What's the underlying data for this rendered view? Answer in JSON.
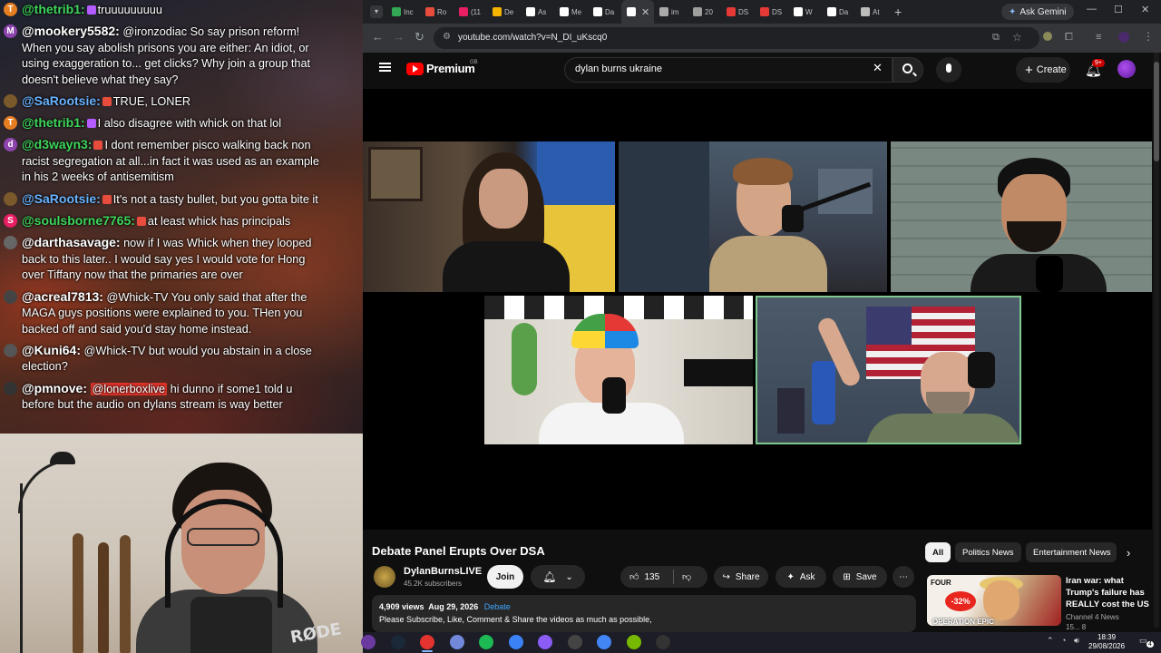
{
  "chat": {
    "messages": [
      {
        "user": "@thetrib1:",
        "avatar": "T",
        "avatar_color": "#e67e22",
        "user_color": "#3ed65b",
        "badge_color": "#b45cff",
        "text": "truuuuuuuuu",
        "mention": ""
      },
      {
        "user": "@mookery5582:",
        "avatar": "M",
        "avatar_color": "#8e44ad",
        "user_color": "#ffffff",
        "badge_color": "",
        "text": "@ironzodiac So say prison reform! When you say abolish prisons you are either: An idiot, or using exaggeration to... get clicks? Why join a group that doesn't believe what they say?",
        "mention": ""
      },
      {
        "user": "@SaRootsie:",
        "avatar": "",
        "avatar_color": "#7a5a2a",
        "user_color": "#68b3ff",
        "badge_color": "#e74c3c",
        "text": "TRUE, LONER",
        "mention": ""
      },
      {
        "user": "@thetrib1:",
        "avatar": "T",
        "avatar_color": "#e67e22",
        "user_color": "#3ed65b",
        "badge_color": "#b45cff",
        "text": "I also disagree with whick on that lol",
        "mention": ""
      },
      {
        "user": "@d3wayn3:",
        "avatar": "d",
        "avatar_color": "#8e44ad",
        "user_color": "#3ed65b",
        "badge_color": "#e74c3c",
        "text": "I dont remember pisco walking back non racist segregation at all...in fact it was used as an example in his 2 weeks of antisemitism",
        "mention": ""
      },
      {
        "user": "@SaRootsie:",
        "avatar": "",
        "avatar_color": "#7a5a2a",
        "user_color": "#68b3ff",
        "badge_color": "#e74c3c",
        "text": "It's not a tasty bullet, but you gotta bite it",
        "mention": ""
      },
      {
        "user": "@soulsborne7765:",
        "avatar": "S",
        "avatar_color": "#e91e63",
        "user_color": "#3ed65b",
        "badge_color": "#e74c3c",
        "text": "at least whick has principals",
        "mention": ""
      },
      {
        "user": "@darthasavage:",
        "avatar": "",
        "avatar_color": "#666666",
        "user_color": "#ffffff",
        "badge_color": "",
        "text": "now if I was Whick when they looped back to this later.. I would say yes I would vote for Hong over Tiffany now that the primaries are over",
        "mention": ""
      },
      {
        "user": "@acreal7813:",
        "avatar": "",
        "avatar_color": "#444444",
        "user_color": "#ffffff",
        "badge_color": "",
        "text": "@Whick-TV You only said that after the MAGA guys positions were explained to you. THen you backed off and said you'd stay home instead.",
        "mention": ""
      },
      {
        "user": "@Kuni64:",
        "avatar": "",
        "avatar_color": "#555555",
        "user_color": "#ffffff",
        "badge_color": "",
        "text": "@Whick-TV but would you abstain in a close election?",
        "mention": ""
      },
      {
        "user": "@pmnove:",
        "avatar": "",
        "avatar_color": "#333333",
        "user_color": "#ffffff",
        "badge_color": "",
        "text": "hi dunno if some1 told u before but the audio on dylans stream is way better",
        "mention": "@lonerboxlive"
      }
    ]
  },
  "cam": {
    "mic_brand": "RØDE"
  },
  "browser": {
    "tabs": [
      {
        "label": "Inc",
        "color": "#34a853"
      },
      {
        "label": "Ro",
        "color": "#e74c3c"
      },
      {
        "label": "(11",
        "color": "#e91e63"
      },
      {
        "label": "De",
        "color": "#f4b400"
      },
      {
        "label": "As",
        "color": "#ffffff"
      },
      {
        "label": "Me",
        "color": "#ffffff"
      },
      {
        "label": "Da",
        "color": "#ffffff"
      },
      {
        "label": "",
        "color": "#ffffff"
      },
      {
        "label": "im",
        "color": "#aaaaaa"
      },
      {
        "label": "20",
        "color": "#9e9e9e"
      },
      {
        "label": "DS",
        "color": "#e53935"
      },
      {
        "label": "DS",
        "color": "#e53935"
      },
      {
        "label": "W",
        "color": "#ffffff"
      },
      {
        "label": "Da",
        "color": "#ffffff"
      },
      {
        "label": "At",
        "color": "#bdbdbd"
      }
    ],
    "ask_gemini": "Ask Gemini",
    "url": "youtube.com/watch?v=N_DI_uKscq0"
  },
  "youtube": {
    "brand": "Premium",
    "region": "GB",
    "search_query": "dylan burns ukraine",
    "create_label": "Create",
    "notif_count": "9+",
    "video_title": "Debate Panel Erupts Over DSA",
    "channel_name": "DylanBurnsLIVE",
    "subscribers": "45.2K subscribers",
    "join_label": "Join",
    "likes": "135",
    "share_label": "Share",
    "ask_label": "Ask",
    "save_label": "Save",
    "views": "4,909 views",
    "date": "Aug 29, 2026",
    "tag": "Debate",
    "description": "Please Subscribe, Like, Comment & Share the videos as much as possible,",
    "chips": [
      "All",
      "Politics News",
      "Entertainment News"
    ],
    "rec": {
      "thumb_badge": "-32%",
      "thumb_top": "FOUR",
      "thumb_bottom": "OPERATION EPIC",
      "title": "Iran war: what Trump's failure has REALLY cost the US",
      "channel": "Channel 4 News",
      "meta": "15... 8"
    }
  },
  "taskbar": {
    "time": "18:39",
    "date": "29/08/2026",
    "notif_count": "4",
    "icons": [
      "#6b3aa0",
      "#1b2838",
      "#e2332e",
      "#7289da",
      "#1db954",
      "#3b82f6",
      "#8b5cf6",
      "#444",
      "#4285f4",
      "#76b900",
      "#333"
    ]
  }
}
